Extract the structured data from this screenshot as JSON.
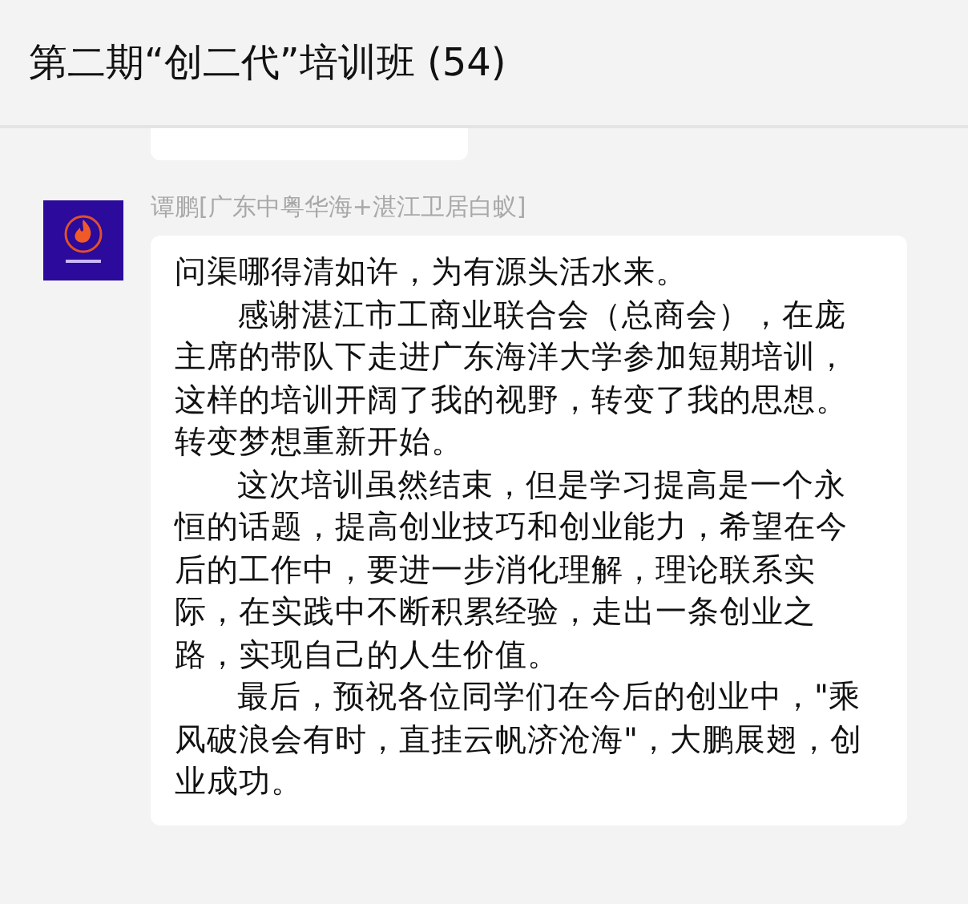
{
  "header": {
    "title": "第二期“创二代”培训班 (54)"
  },
  "messages": [
    {
      "kind": "cut"
    },
    {
      "kind": "text",
      "sender": "谭鹏[广东中粤华海+湛江卫居白蚁]",
      "paragraphs": [
        "问渠哪得清如许，为有源头活水来。",
        "感谢湛江市工商业联合会（总商会），在庞主席的带队下走进广东海洋大学参加短期培训，这样的培训开阔了我的视野，转变了我的思想。转变梦想重新开始。",
        "这次培训虽然结束，但是学习提高是一个永恒的话题，提高创业技巧和创业能力，希望在今后的工作中，要进一步消化理解，理论联系实际，在实践中不断积累经验，走出一条创业之路，实现自己的人生价值。",
        "最后，预祝各位同学们在今后的创业中，\"乘风破浪会有时，直挂云帆济沧海\"，大鹏展翅，创业成功。"
      ]
    }
  ]
}
